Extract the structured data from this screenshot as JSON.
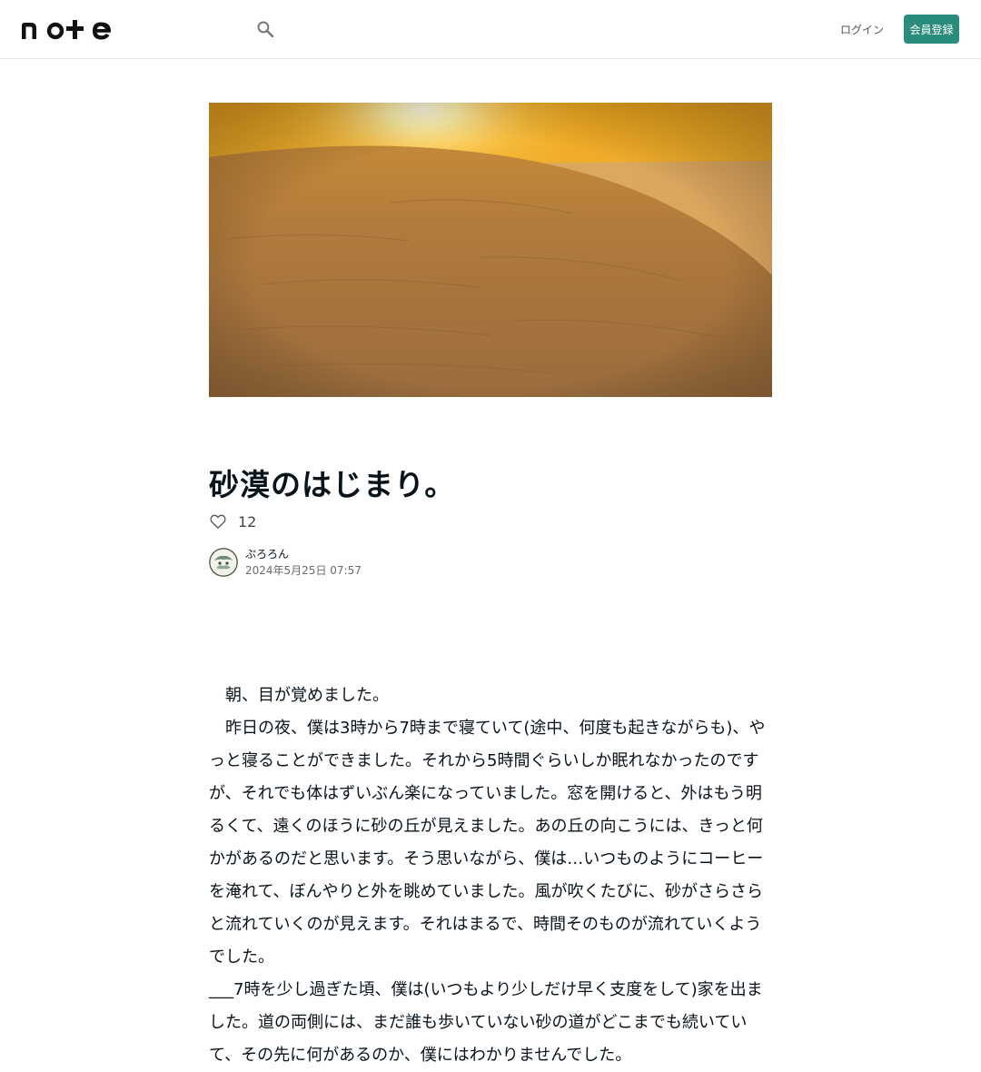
{
  "header": {
    "logo_text": "note",
    "login_label": "ログイン",
    "signup_label": "会員登録"
  },
  "article": {
    "title": "砂漠のはじまり。",
    "likes": "12",
    "author_name": "ぷろろん",
    "date": "2024年5月25日 07:57",
    "paragraphs": [
      "　朝、目が覚めました。",
      "　昨日の夜、僕は3時から7時まで寝ていて(途中、何度も起きながらも)、やっと寝ることができました。それから5時間ぐらいしか眠れなかったのですが、それでも体はずいぶん楽になっていました。窓を開けると、外はもう明るくて、遠くのほうに砂の丘が見えました。あの丘の向こうには、きっと何かがあるのだと思います。そう思いながら、僕は…いつものようにコーヒーを淹れて、ぼんやりと外を眺めていました。風が吹くたびに、砂がさらさらと流れていくのが見えます。それはまるで、時間そのものが流れていくようでした。",
      "___7時を少し過ぎた頃、僕は(いつもより少しだけ早く支度をして)家を出ました。道の両側には、まだ誰も歩いていない砂の道がどこまでも続いていて、その先に何があるのか、僕にはわかりませんでした。"
    ]
  },
  "icons": {
    "search": "search-icon",
    "heart": "heart-icon",
    "avatar": "avatar-image"
  },
  "colors": {
    "accent": "#2a8c7a",
    "text": "#08131a",
    "muted": "#6b6b6b"
  }
}
